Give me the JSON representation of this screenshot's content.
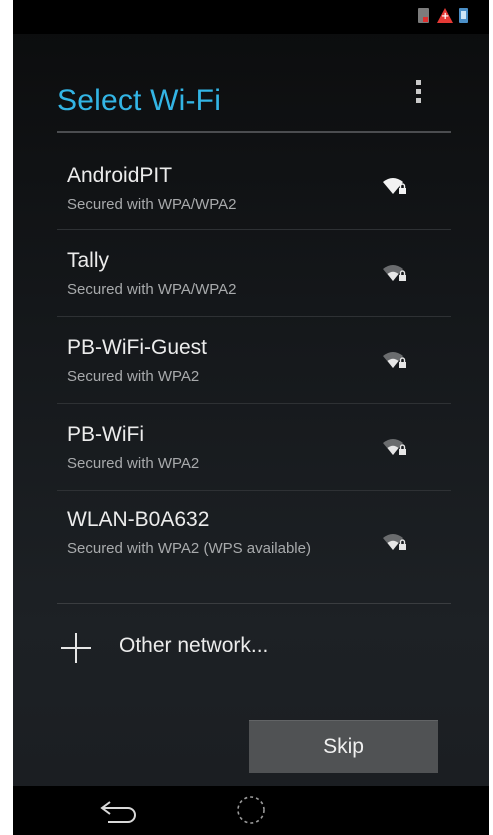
{
  "status_bar": {
    "icons": [
      "sim-card-icon",
      "warning-icon",
      "battery-charging-icon"
    ],
    "colors": {
      "warning": "#e53935",
      "battery": "#4b8fc7"
    }
  },
  "header": {
    "title": "Select Wi-Fi",
    "menu_icon": "overflow-menu-icon",
    "title_color": "#33b5e5"
  },
  "networks": [
    {
      "name": "AndroidPIT",
      "security": "Secured with WPA/WPA2",
      "icon": "wifi-lock-icon",
      "signal": "strong"
    },
    {
      "name": "Tally",
      "security": "Secured with WPA/WPA2",
      "icon": "wifi-lock-icon",
      "signal": "medium"
    },
    {
      "name": "PB-WiFi-Guest",
      "security": "Secured with WPA2",
      "icon": "wifi-lock-icon",
      "signal": "medium"
    },
    {
      "name": "PB-WiFi",
      "security": "Secured with WPA2",
      "icon": "wifi-lock-icon",
      "signal": "medium"
    },
    {
      "name": "WLAN-B0A632",
      "security": "Secured with WPA2 (WPS available)",
      "icon": "wifi-lock-icon",
      "signal": "medium"
    }
  ],
  "add_network": {
    "label": "Other network...",
    "icon": "plus-icon"
  },
  "footer": {
    "skip_label": "Skip"
  },
  "nav_bar": {
    "icons": [
      "back-icon",
      "home-icon"
    ]
  }
}
